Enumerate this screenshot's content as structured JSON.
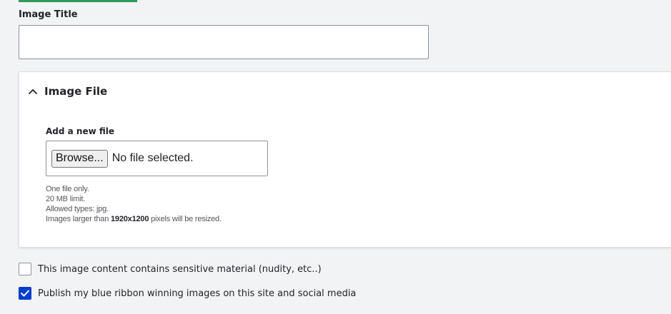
{
  "form": {
    "title_label": "Image Title",
    "title_value": "",
    "title_placeholder": ""
  },
  "image_file": {
    "section_title": "Image File",
    "add_label": "Add a new file",
    "browse_label": "Browse...",
    "file_status": "No file selected.",
    "help": {
      "line1": "One file only.",
      "line2": "20 MB limit.",
      "line3": "Allowed types: jpg.",
      "line4_prefix": "Images larger than",
      "line4_dimensions": "1920x1200",
      "line4_suffix": "pixels will be resized."
    },
    "expanded": true,
    "icon": "chevron-up-icon"
  },
  "checkboxes": [
    {
      "label": "This image content contains sensitive material (nudity, etc..)",
      "checked": false
    },
    {
      "label": "Publish my blue ribbon winning images on this site and social media",
      "checked": true
    }
  ],
  "colors": {
    "accent": "#003ecc",
    "top_accent": "#2f9a57",
    "background": "#f2f3f5"
  }
}
